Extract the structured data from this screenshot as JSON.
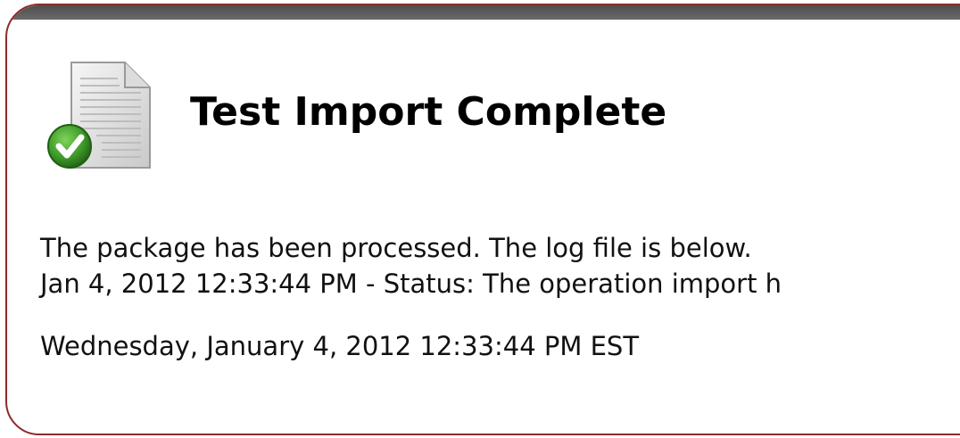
{
  "dialog": {
    "title": "Test Import Complete",
    "icon": "document-check-icon",
    "accent_color": "#8c2a2a",
    "success_color": "#3e9a2a"
  },
  "log": {
    "line_1": "The package has been processed. The log file is below.",
    "line_2": "Jan 4, 2012 12:33:44 PM - Status: The operation import h"
  },
  "footer": {
    "timestamp": "Wednesday, January 4, 2012 12:33:44 PM EST"
  }
}
